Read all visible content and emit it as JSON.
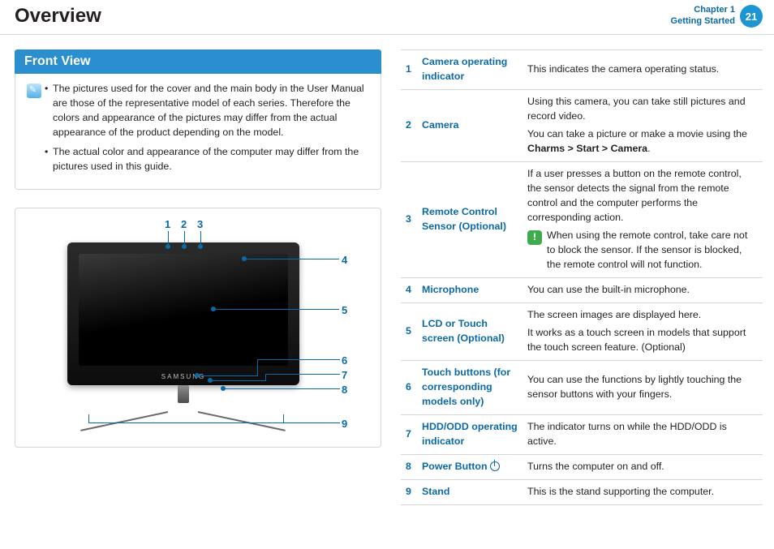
{
  "header": {
    "title": "Overview",
    "chapter_line1": "Chapter 1",
    "chapter_line2": "Getting Started",
    "page_number": "21"
  },
  "section": {
    "title": "Front View"
  },
  "notes": {
    "items": [
      "The pictures used for the cover and the main body in the User Manual are those of the representative model of each series. Therefore the colors and appearance of the pictures may differ from the actual appearance of the product depending on the model.",
      "The actual color and appearance of the computer may differ from the pictures used in this guide."
    ]
  },
  "diagram": {
    "callouts": [
      "1",
      "2",
      "3",
      "4",
      "5",
      "6",
      "7",
      "8",
      "9"
    ],
    "logo": "SAMSUNG"
  },
  "table": {
    "rows": [
      {
        "num": "1",
        "term": "Camera operating indicator",
        "desc_paras": [
          "This indicates the camera operating status."
        ]
      },
      {
        "num": "2",
        "term": "Camera",
        "desc_paras": [
          "Using this camera, you can take still pictures and record video.",
          "You can take a picture or make a movie using the <b>Charms > Start > Camera</b>."
        ]
      },
      {
        "num": "3",
        "term": "Remote Control Sensor (Optional)",
        "desc_paras": [
          "If a user presses a button on the remote control, the sensor detects the signal from the remote control and the computer performs the corresponding action."
        ],
        "caution": "When using the remote control, take care not to block the sensor. If the sensor is blocked, the remote control will not function."
      },
      {
        "num": "4",
        "term": "Microphone",
        "desc_paras": [
          "You can use the built-in microphone."
        ]
      },
      {
        "num": "5",
        "term": "LCD or Touch screen (Optional)",
        "desc_paras": [
          "The screen images are displayed here.",
          "It works as a touch screen in models that support the touch screen feature. (Optional)"
        ]
      },
      {
        "num": "6",
        "term": "Touch buttons (for corresponding models only)",
        "desc_paras": [
          "You can use the functions by lightly touching the sensor buttons with your fingers."
        ]
      },
      {
        "num": "7",
        "term": "HDD/ODD operating indicator",
        "desc_paras": [
          "The indicator turns on while the HDD/ODD is active."
        ]
      },
      {
        "num": "8",
        "term": "Power Button",
        "power_icon": true,
        "desc_paras": [
          "Turns the computer on and off."
        ]
      },
      {
        "num": "9",
        "term": "Stand",
        "desc_paras": [
          "This is the stand supporting the computer."
        ]
      }
    ]
  }
}
